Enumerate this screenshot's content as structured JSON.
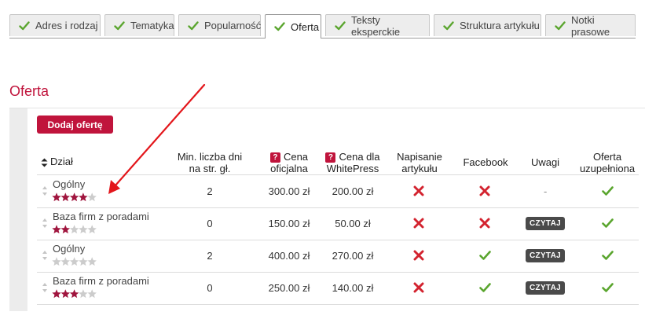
{
  "tabs": [
    {
      "label": "Adres i rodzaj",
      "active": false
    },
    {
      "label": "Tematyka",
      "active": false
    },
    {
      "label": "Popularność",
      "active": false
    },
    {
      "label": "Oferta",
      "active": true
    },
    {
      "label": "Teksty eksperckie",
      "active": false
    },
    {
      "label": "Struktura artykułu",
      "active": false
    },
    {
      "label": "Notki prasowe",
      "active": false
    }
  ],
  "section_title": "Oferta",
  "add_offer_label": "Dodaj ofertę",
  "columns": {
    "dzial": "Dział",
    "min_line1": "Min. liczba dni",
    "min_line2": "na str. gł.",
    "cena_line1": "Cena",
    "cena_line2": "oficjalna",
    "cena_wp_line1": "Cena dla",
    "cena_wp_line2": "WhitePress",
    "napisanie_line1": "Napisanie",
    "napisanie_line2": "artykułu",
    "facebook": "Facebook",
    "uwagi": "Uwagi",
    "oferta_line1": "Oferta",
    "oferta_line2": "uzupełniona",
    "help_icon": "?"
  },
  "rows": [
    {
      "name": "Ogólny",
      "rating": 4,
      "min_days": "2",
      "price": "300.00 zł",
      "wp_price": "200.00 zł",
      "article": false,
      "facebook": false,
      "notes": "-",
      "complete": true
    },
    {
      "name": "Baza firm z poradami",
      "rating": 2,
      "min_days": "0",
      "price": "150.00 zł",
      "wp_price": "50.00 zł",
      "article": false,
      "facebook": false,
      "notes": "CZYTAJ",
      "complete": true
    },
    {
      "name": "Ogólny",
      "rating": 0,
      "min_days": "2",
      "price": "400.00 zł",
      "wp_price": "270.00 zł",
      "article": false,
      "facebook": true,
      "notes": "CZYTAJ",
      "complete": true
    },
    {
      "name": "Baza firm z poradami",
      "rating": 3,
      "min_days": "0",
      "price": "250.00 zł",
      "wp_price": "140.00 zł",
      "article": false,
      "facebook": true,
      "notes": "CZYTAJ",
      "complete": true
    }
  ],
  "colors": {
    "accent": "#c0143c",
    "star_on": "#a0153e",
    "star_off": "#cccccc",
    "check": "#5aa52e",
    "cross": "#d3232f",
    "arrow": "#e3161b"
  },
  "icons": [
    "check-icon",
    "sort-icon",
    "help-icon",
    "star-icon",
    "cross-icon",
    "annotation-arrow"
  ]
}
